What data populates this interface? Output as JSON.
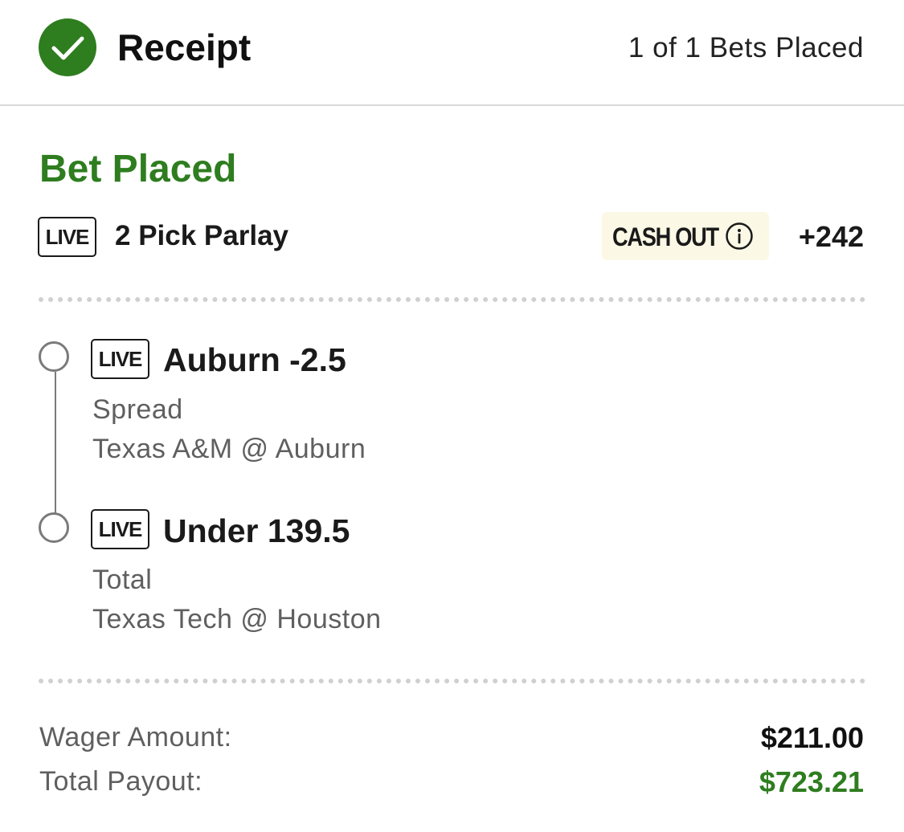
{
  "header": {
    "title": "Receipt",
    "bets_count": "1 of 1 Bets Placed",
    "status_icon": "checkmark-circle-icon"
  },
  "bet": {
    "status": "Bet Placed",
    "live_badge": "LIVE",
    "title": "2 Pick Parlay",
    "cash_out_label": "CASH OUT",
    "cash_out_icon": "info-icon",
    "odds": "+242"
  },
  "legs": [
    {
      "live_badge": "LIVE",
      "selection": "Auburn -2.5",
      "market": "Spread",
      "game": "Texas A&M @ Auburn"
    },
    {
      "live_badge": "LIVE",
      "selection": "Under 139.5",
      "market": "Total",
      "game": "Texas Tech @ Houston"
    }
  ],
  "summary": {
    "wager_label": "Wager Amount:",
    "wager_value": "$211.00",
    "payout_label": "Total Payout:",
    "payout_value": "$723.21"
  },
  "colors": {
    "accent_green": "#2e7d1f",
    "cash_out_background": "#fbf8e6"
  }
}
